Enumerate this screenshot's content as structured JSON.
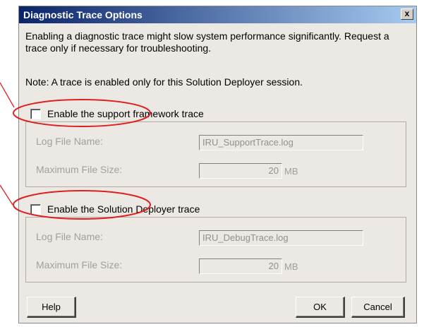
{
  "dialog": {
    "title": "Diagnostic Trace Options",
    "close_glyph": "x",
    "description": "Enabling a diagnostic trace might slow system performance significantly. Request a trace only if necessary for troubleshooting.",
    "note": "Note: A trace is enabled only for this Solution Deployer session."
  },
  "support_trace": {
    "checkbox_label": "Enable the support framework trace",
    "checked": false,
    "log_file_label": "Log File Name:",
    "log_file_value": "IRU_SupportTrace.log",
    "max_size_label": "Maximum File Size:",
    "max_size_value": "20",
    "max_size_unit": "MB"
  },
  "deployer_trace": {
    "checkbox_label": "Enable the Solution Deployer trace",
    "checked": false,
    "log_file_label": "Log File Name:",
    "log_file_value": "IRU_DebugTrace.log",
    "max_size_label": "Maximum File Size:",
    "max_size_value": "20",
    "max_size_unit": "MB"
  },
  "buttons": {
    "help": "Help",
    "ok": "OK",
    "cancel": "Cancel"
  },
  "colors": {
    "annotation": "#e02020",
    "title_bar_start": "#0a246a",
    "title_bar_end": "#a6caf0",
    "dialog_face": "#ece9e4"
  }
}
